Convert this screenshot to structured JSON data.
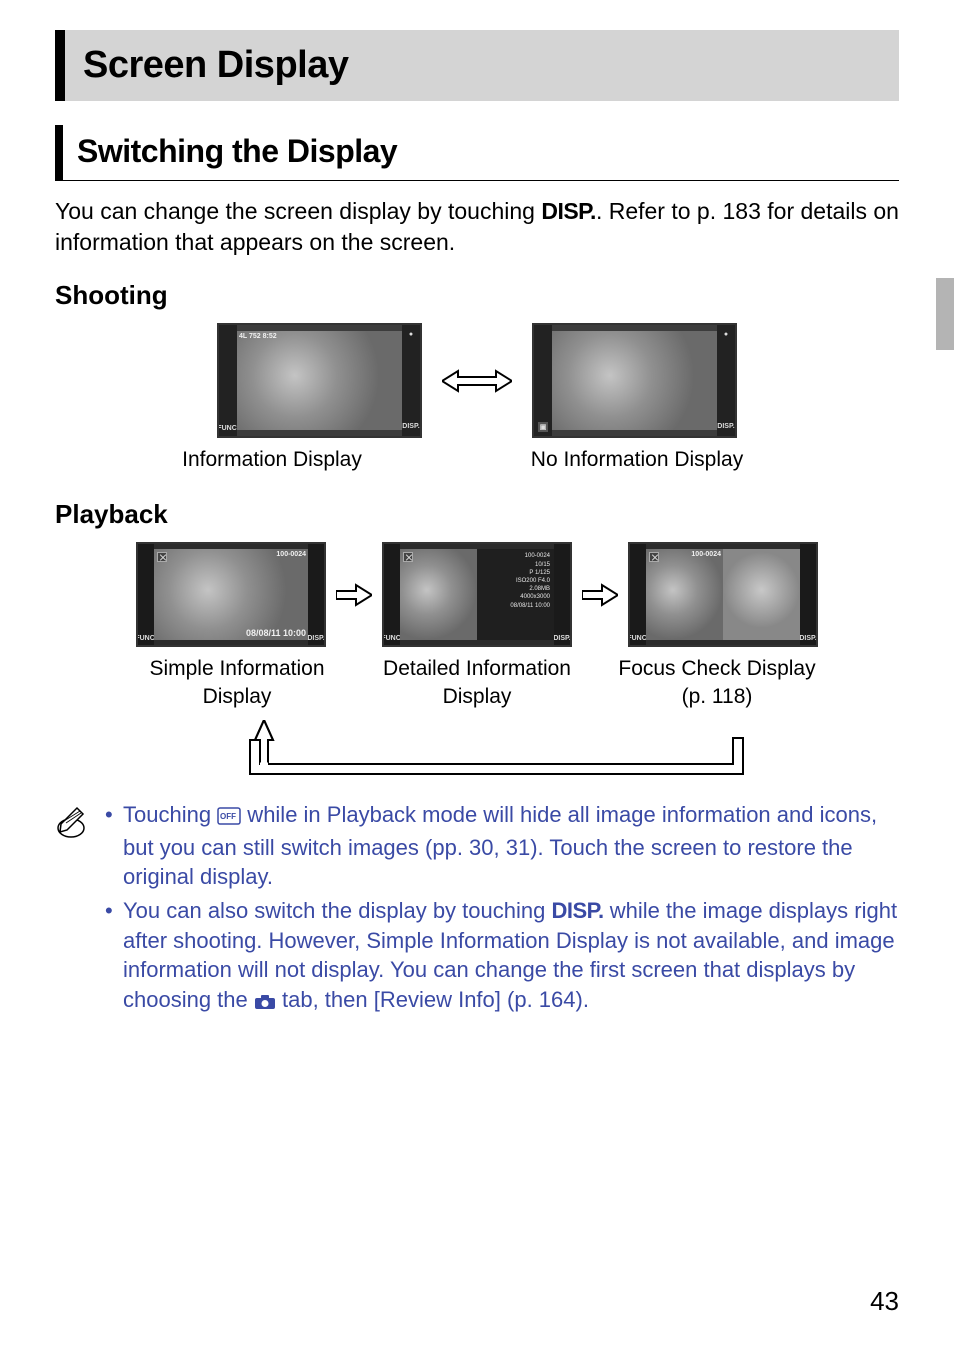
{
  "title": "Screen Display",
  "subsection": "Switching the Display",
  "intro_part1": "You can change the screen display by touching ",
  "intro_disp": "DISP.",
  "intro_part2": ". Refer to p. 183 for details on information that appears on the screen.",
  "shooting_heading": "Shooting",
  "shooting_caption_left": "Information Display",
  "shooting_caption_right": "No Information Display",
  "playback_heading": "Playback",
  "playback_caption_1": "Simple Information Display",
  "playback_caption_2": "Detailed Information Display",
  "playback_caption_3": "Focus Check Display (p. 118)",
  "note1_part1": "Touching ",
  "note1_part2": " while in Playback mode will hide all image information and icons, but you can still switch images (pp. 30, 31). Touch the screen to restore the original display.",
  "note2_part1": "You can also switch the display by touching ",
  "note2_disp": "DISP.",
  "note2_part2": " while the image displays right after shooting. However, Simple Information Display is not available, and image information will not display. You can change the first screen that displays by choosing the ",
  "note2_part3": " tab, then [Review Info] (p. 164).",
  "page_number": "43",
  "overlay": {
    "shoot_top": "4L 752   8:52",
    "func": "FUNC.",
    "disp": "DISP.",
    "pb_top": "100-0024",
    "pb_date": "08/08/11  10:00",
    "detail": {
      "folder": "100-0024",
      "count": "10/15",
      "shutter": "P   1/125",
      "iso": "ISO200  F4.0",
      "size": "2.08MB",
      "res": "4000x3000",
      "dt": "08/08/11  10:00"
    }
  }
}
